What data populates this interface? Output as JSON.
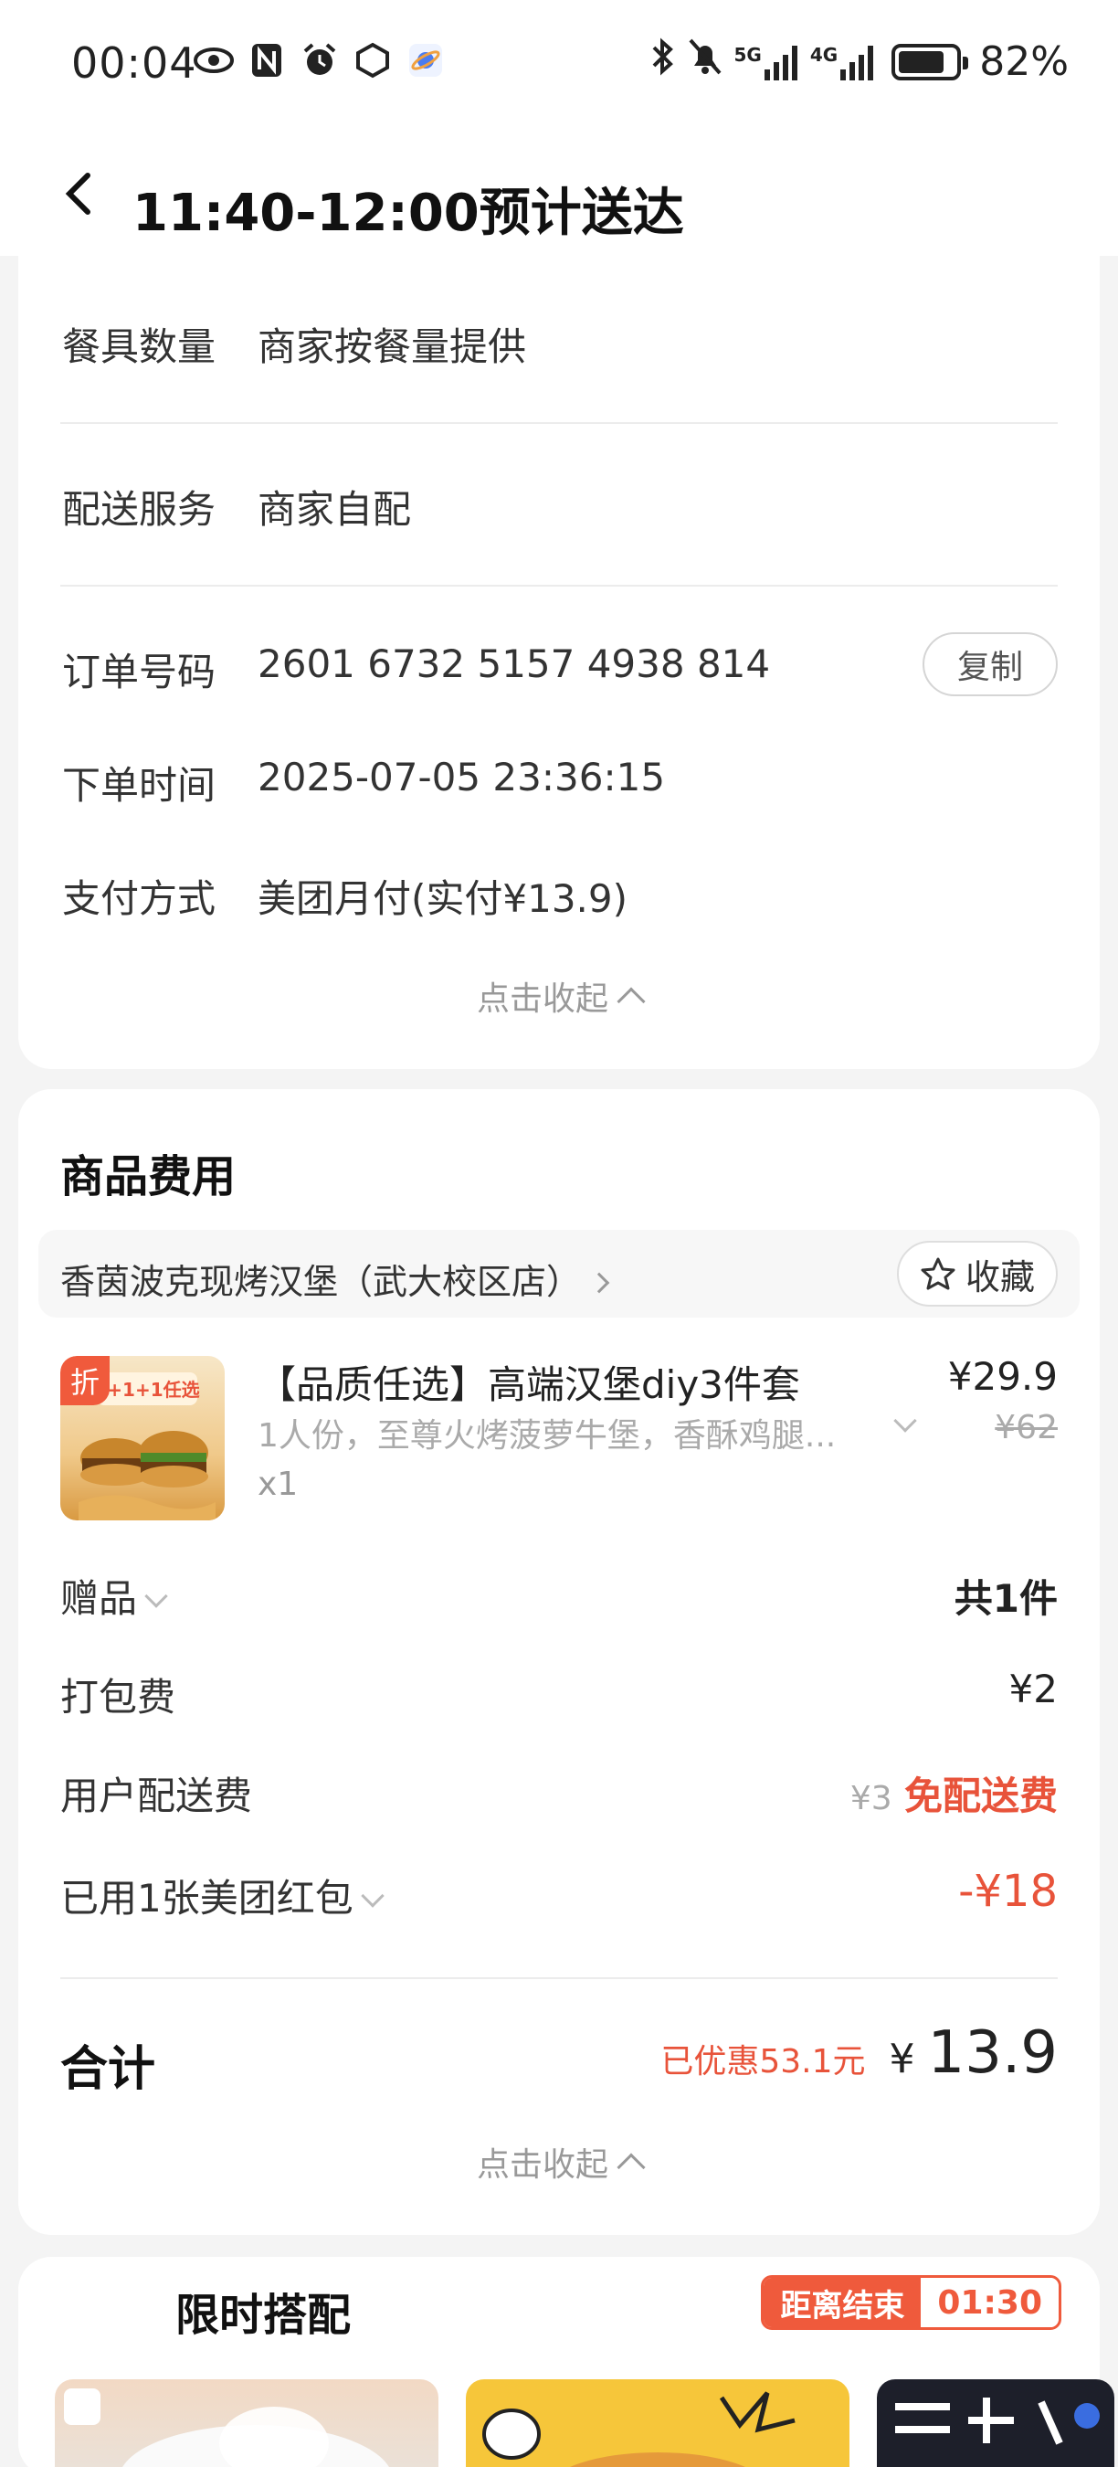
{
  "status_bar": {
    "time": "00:04",
    "battery": "82%",
    "battery_level": 0.82,
    "icons": [
      "eye-icon",
      "nfc-icon",
      "alarm-icon",
      "hexagon-icon",
      "planet-icon",
      "bluetooth-icon",
      "mute-bell-icon",
      "5g-signal-icon",
      "4g-signal-icon",
      "battery-icon"
    ],
    "net1": "5G",
    "net2": "4G"
  },
  "header": {
    "title": "11:40-12:00预计送达"
  },
  "order_info": {
    "rows": [
      {
        "label": "餐具数量",
        "value": "商家按餐量提供"
      },
      {
        "label": "配送服务",
        "value": "商家自配"
      },
      {
        "label": "订单号码",
        "value": "2601 6732 5157 4938 814"
      },
      {
        "label": "下单时间",
        "value": "2025-07-05 23:36:15"
      },
      {
        "label": "支付方式",
        "value": "美团月付(实付¥13.9)"
      }
    ],
    "copy_label": "复制",
    "collapse_label": "点击收起"
  },
  "goods": {
    "title": "商品费用",
    "store_name": "香茵波克现烤汉堡（武大校区店）",
    "fav_label": "收藏",
    "product": {
      "badge": "折",
      "name": "【品质任选】高端汉堡diy3件套",
      "desc": "1人份，至尊火烤菠萝牛堡，香酥鸡腿...",
      "qty": "x1",
      "price": "¥29.9",
      "original_price": "¥62",
      "image_text": "1+1+1任选"
    },
    "gift_label": "赠品",
    "gift_value": "共1件",
    "packing_label": "打包费",
    "packing_value": "¥2",
    "delivery_label": "用户配送费",
    "delivery_old": "¥3",
    "delivery_value": "免配送费",
    "coupon_label": "已用1张美团红包",
    "coupon_value": "-¥18",
    "total_label": "合计",
    "saved": "已优惠53.1元",
    "total_currency": "¥",
    "total_value": "13.9",
    "collapse_label": "点击收起"
  },
  "combo": {
    "title": "限时搭配",
    "countdown_label": "距离结束",
    "countdown": "01:30"
  },
  "colors": {
    "accent": "#e8533a",
    "background": "#f4f4f4"
  }
}
